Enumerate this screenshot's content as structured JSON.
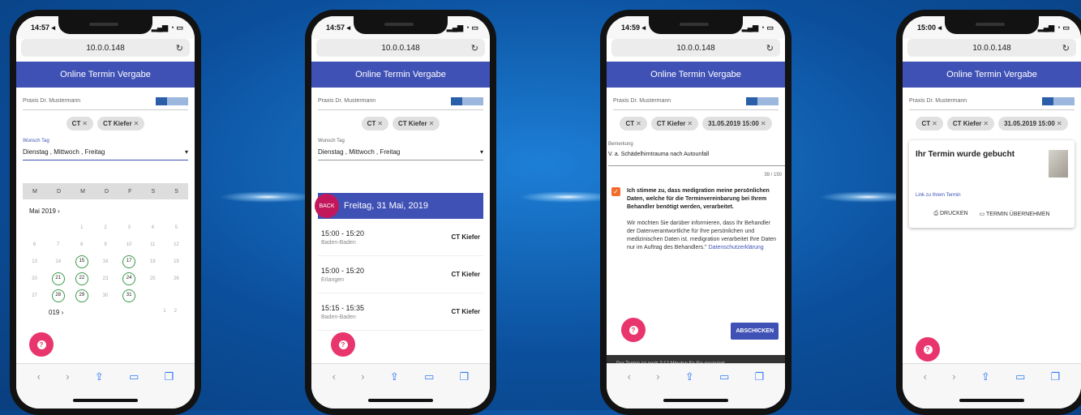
{
  "app_title": "Online Termin Vergabe",
  "url": "10.0.0.148",
  "practice": "Praxis Dr. Mustermann",
  "phone1": {
    "time": "14:57 ◂",
    "chips": [
      "CT",
      "CT Kiefer"
    ],
    "wish_label": "Wunsch Tag",
    "wish_value": "Dienstag , Mittwoch , Freitag",
    "weekdays": [
      "M",
      "D",
      "M",
      "D",
      "F",
      "S",
      "S"
    ],
    "month": "Mai 2019",
    "next_month": "019",
    "days": [
      "",
      "",
      "1",
      "2",
      "3",
      "4",
      "5",
      "6",
      "7",
      "8",
      "9",
      "10",
      "11",
      "12",
      "13",
      "14",
      "15",
      "16",
      "17",
      "18",
      "19",
      "20",
      "21",
      "22",
      "23",
      "24",
      "25",
      "26",
      "27",
      "28",
      "29",
      "30",
      "31",
      "",
      ""
    ],
    "available": [
      "15",
      "17",
      "21",
      "22",
      "24",
      "28",
      "29",
      "31"
    ],
    "next_days": [
      "1",
      "2"
    ]
  },
  "phone2": {
    "time": "14:57 ◂",
    "chips": [
      "CT",
      "CT Kiefer"
    ],
    "wish_label": "Wunsch Tag",
    "wish_value": "Dienstag , Mittwoch , Freitag",
    "back_label": "BACK",
    "date_title": "Freitag, 31 Mai, 2019",
    "slots": [
      {
        "time": "15:00 - 15:20",
        "loc": "Baden-Baden",
        "device": "CT Kiefer"
      },
      {
        "time": "15:00 - 15:20",
        "loc": "Erlangen",
        "device": "CT Kiefer"
      },
      {
        "time": "15:15 - 15:35",
        "loc": "Baden-Baden",
        "device": "CT Kiefer"
      }
    ]
  },
  "phone3": {
    "time": "14:59 ◂",
    "chips": [
      "CT",
      "CT Kiefer",
      "31.05.2019 15:00"
    ],
    "remark_label": "Bemerkung",
    "remark_value": "V. a. Schädelhirntrauma nach Autounfall",
    "counter": "39 / 150",
    "consent": "Ich stimme zu, dass medigration meine persönlichen Daten, welche für die Terminvereinbarung bei Ihrem Behandler benötigt werden, verarbeitet.",
    "info": "Wir möchten Sie darüber informieren, dass Ihr Behandler der Datenverantwortliche für Ihre persönlichen und medizinischen Daten ist. medigration verarbeitet Ihre Daten nur im Auftrag des Behandlers.\"",
    "privacy_link": "Datenschutzerklärung",
    "send_label": "ABSCHICKEN",
    "snackbar": "Der Termin ist noch 2:12 Minuten für Sie reserviert"
  },
  "phone4": {
    "time": "15:00 ◂",
    "chips": [
      "CT",
      "CT Kiefer",
      "31.05.2019 15:00"
    ],
    "booked_title": "Ihr Termin wurde gebucht",
    "link": "Link zu Ihrem Termin",
    "print_label": "DRUCKEN",
    "take_label": "TERMIN ÜBERNEHMEN"
  },
  "colors": {
    "primary": "#3f51b5",
    "fab": "#e8356d",
    "available": "#3b9a4a",
    "checkbox": "#f26c2b"
  },
  "icons": [
    "help-icon",
    "share-icon",
    "bookmarks-icon",
    "tabs-icon",
    "print-icon",
    "calendar-icon",
    "close-icon",
    "reload-icon"
  ]
}
